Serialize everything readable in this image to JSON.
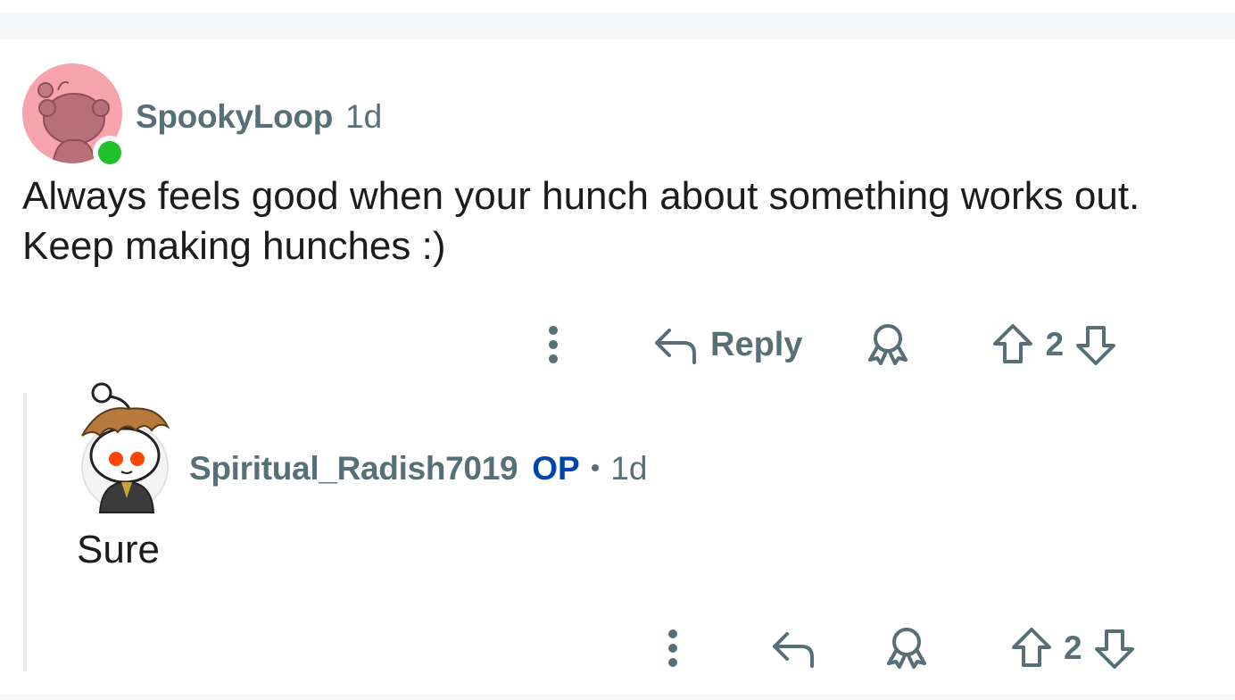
{
  "comments": [
    {
      "author": "SpookyLoop",
      "age": "1d",
      "body": "Always feels good when your hunch about something works out. Keep making hunches :)",
      "reply_label": "Reply",
      "votes": "2",
      "online": true
    },
    {
      "author": "Spiritual_Radish7019",
      "op_badge": "OP",
      "separator": "•",
      "age": "1d",
      "body": "Sure",
      "votes": "2"
    }
  ],
  "icons": {
    "more": "more-vertical-icon",
    "reply": "reply-arrow-icon",
    "award": "award-icon",
    "upvote": "upvote-arrow-icon",
    "downvote": "downvote-arrow-icon"
  },
  "colors": {
    "meta_text": "#576f76",
    "body_text": "#1c1c1c",
    "op_blue": "#0045ac",
    "online_green": "#1fc22b",
    "avatar_pink": "#f7a3ac"
  }
}
